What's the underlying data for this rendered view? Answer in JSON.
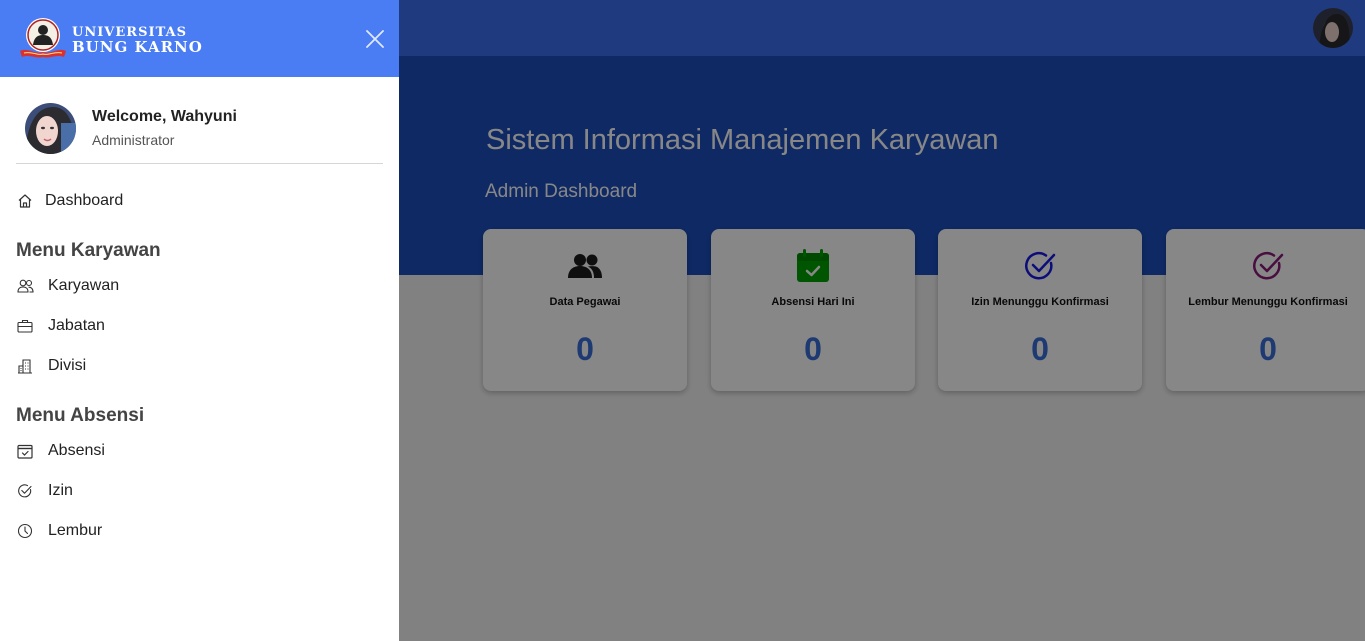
{
  "brand": {
    "line1": "UNIVERSITAS",
    "line2": "BUNG KARNO"
  },
  "user": {
    "welcome": "Welcome, Wahyuni",
    "role": "Administrator"
  },
  "nav": {
    "dashboard": "Dashboard",
    "section_karyawan": "Menu Karyawan",
    "karyawan_items": [
      {
        "label": "Karyawan",
        "icon": "users-icon"
      },
      {
        "label": "Jabatan",
        "icon": "briefcase-icon"
      },
      {
        "label": "Divisi",
        "icon": "building-icon"
      }
    ],
    "section_absensi": "Menu Absensi",
    "absensi_items": [
      {
        "label": "Absensi",
        "icon": "calendar-check-icon"
      },
      {
        "label": "Izin",
        "icon": "check-circle-icon"
      },
      {
        "label": "Lembur",
        "icon": "clock-icon"
      }
    ]
  },
  "main": {
    "title": "Sistem Informasi Manajemen Karyawan",
    "subtitle": "Admin Dashboard"
  },
  "cards": [
    {
      "label": "Data Pegawai",
      "count": "0",
      "icon": "users-icon",
      "color": "#1e1e1e"
    },
    {
      "label": "Absensi Hari Ini",
      "count": "0",
      "icon": "calendar-check-icon",
      "color": "#00a000"
    },
    {
      "label": "Izin Menunggu Konfirmasi",
      "count": "0",
      "icon": "check-circle-icon",
      "color": "#1a1ae6"
    },
    {
      "label": "Lembur Menunggu Konfirmasi",
      "count": "0",
      "icon": "check-circle-icon",
      "color": "#8a1a7a"
    }
  ],
  "colors": {
    "topbar": "#3b6ff0",
    "hero": "#1d4fbf",
    "drawer_header": "#4a7cf3",
    "count": "#3a6fd8"
  }
}
